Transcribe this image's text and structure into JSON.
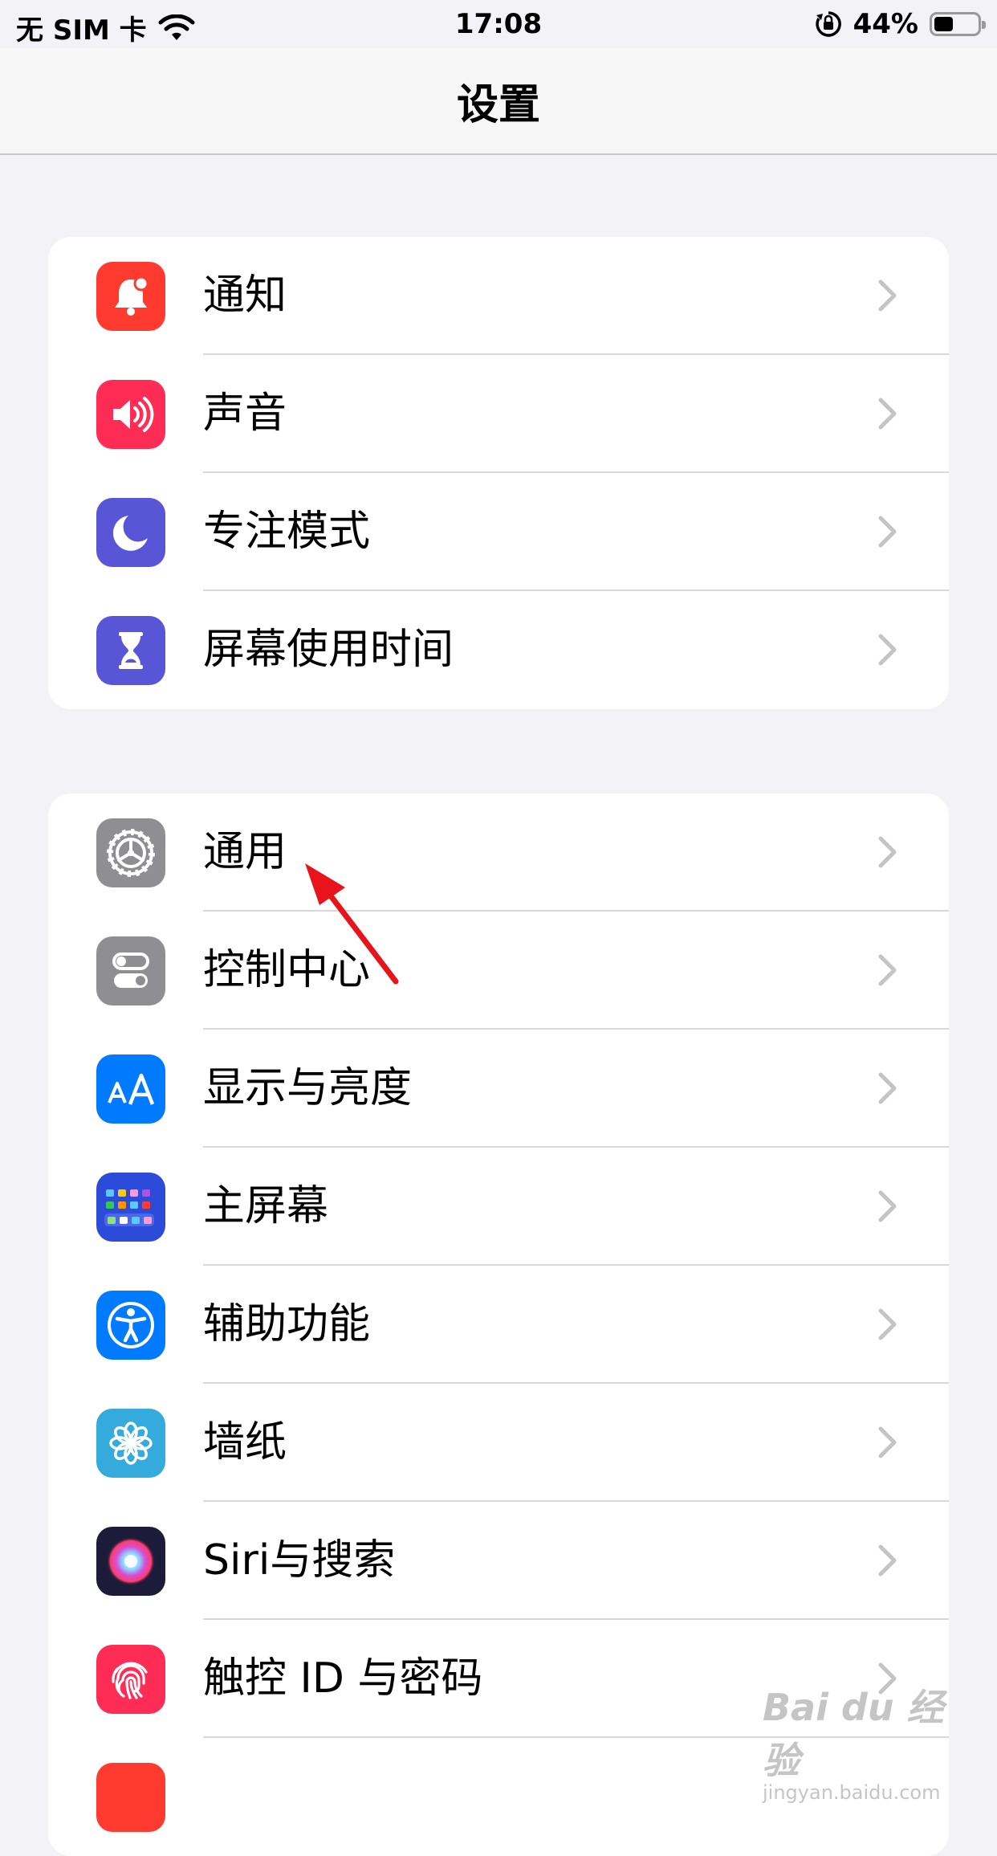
{
  "status_bar": {
    "carrier": "无 SIM 卡",
    "time": "17:08",
    "battery_percent_label": "44%",
    "battery_level": 0.44
  },
  "nav": {
    "title": "设置"
  },
  "group1": [
    {
      "label": "通知",
      "icon": "bell-icon",
      "color": "#ff3b30"
    },
    {
      "label": "声音",
      "icon": "speaker-icon",
      "color": "#ff2d55"
    },
    {
      "label": "专注模式",
      "icon": "moon-icon",
      "color": "#5856d6"
    },
    {
      "label": "屏幕使用时间",
      "icon": "hourglass-icon",
      "color": "#5856d6"
    }
  ],
  "group2": [
    {
      "label": "通用",
      "icon": "gear-icon",
      "color": "#8e8e93"
    },
    {
      "label": "控制中心",
      "icon": "toggles-icon",
      "color": "#8e8e93"
    },
    {
      "label": "显示与亮度",
      "icon": "text-size-icon",
      "color": "#007aff"
    },
    {
      "label": "主屏幕",
      "icon": "home-grid-icon",
      "color": "#2c4bd8"
    },
    {
      "label": "辅助功能",
      "icon": "accessibility-icon",
      "color": "#007aff"
    },
    {
      "label": "墙纸",
      "icon": "flower-icon",
      "color": "#35aadc"
    },
    {
      "label": "Siri与搜索",
      "icon": "siri-icon",
      "color": "#1c1c3a"
    },
    {
      "label": "触控 ID 与密码",
      "icon": "fingerprint-icon",
      "color": "#ff2d55"
    }
  ],
  "watermark": {
    "main": "Bai du 经验",
    "sub": "jingyan.baidu.com"
  }
}
